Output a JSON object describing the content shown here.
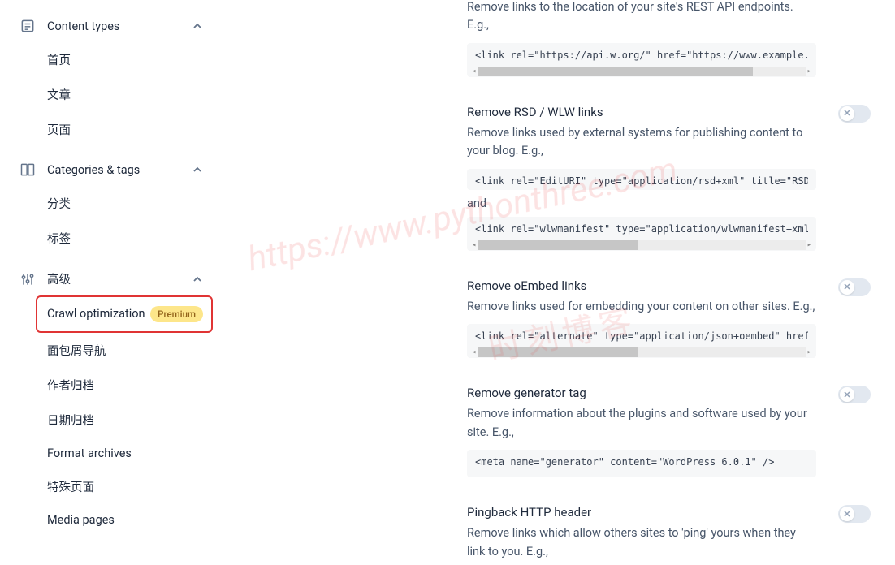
{
  "sidebar": {
    "sections": [
      {
        "label": "Content types",
        "icon": "content-types",
        "items": [
          "首页",
          "文章",
          "页面"
        ]
      },
      {
        "label": "Categories & tags",
        "icon": "categories",
        "items": [
          "分类",
          "标签"
        ]
      },
      {
        "label": "高级",
        "icon": "advanced",
        "items": [
          {
            "label": "Crawl optimization",
            "badge": "Premium",
            "highlighted": true
          },
          "面包屑导航",
          "作者归档",
          "日期归档",
          "Format archives",
          "特殊页面",
          "Media pages"
        ]
      }
    ]
  },
  "content": {
    "sections": [
      {
        "title": "",
        "desc": "Remove links to the location of your site's REST API endpoints. E.g.,",
        "code": "<link rel=\"https://api.w.org/\" href=\"https://www.example.com/wp-",
        "thumb_width": "84%",
        "toggle": false
      },
      {
        "title": "Remove RSD / WLW links",
        "desc": "Remove links used by external systems for publishing content to your blog. E.g.,",
        "code": "<link rel=\"EditURI\" type=\"application/rsd+xml\" title=\"RSD\" href=",
        "sep": "and",
        "code2": "<link rel=\"wlwmanifest\" type=\"application/wlwmanifest+xml\" href=",
        "thumb_width": "49%",
        "toggle": true
      },
      {
        "title": "Remove oEmbed links",
        "desc": "Remove links used for embedding your content on other sites. E.g.,",
        "code": "<link rel=\"alternate\" type=\"application/json+oembed\" href=\"https",
        "thumb_width": "49%",
        "toggle": true
      },
      {
        "title": "Remove generator tag",
        "desc": "Remove information about the plugins and software used by your site. E.g.,",
        "code": "<meta name=\"generator\" content=\"WordPress 6.0.1\" />",
        "no_scroll": true,
        "toggle": true
      },
      {
        "title": "Pingback HTTP header",
        "desc": "Remove links which allow others sites to 'ping' yours when they link to you. E.g.,",
        "toggle": true
      }
    ]
  },
  "watermark1": "https://www.pythonthree.com",
  "watermark2": "时刻博客"
}
